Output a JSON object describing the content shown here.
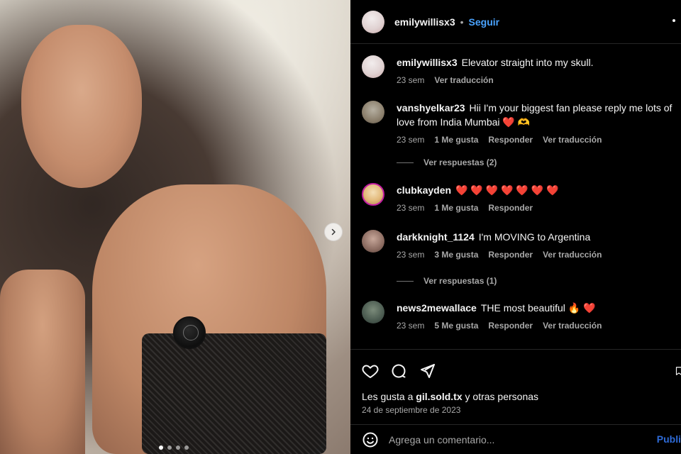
{
  "post": {
    "username": "emilywillisx3",
    "separator": "•",
    "follow_label": "Seguir"
  },
  "comments": [
    {
      "username": "emilywillisx3",
      "text": "Elevator straight into my skull.",
      "time": "23 sem",
      "translate_label": "Ver traducción"
    },
    {
      "username": "vanshyelkar23",
      "text": "Hii I'm your biggest fan please reply me lots of love from India Mumbai ❤️ 🫶",
      "time": "23 sem",
      "likes": "1 Me gusta",
      "reply_label": "Responder",
      "translate_label": "Ver traducción",
      "view_replies": "Ver respuestas (2)"
    },
    {
      "username": "clubkayden",
      "text": "❤️ ❤️ ❤️ ❤️ ❤️ ❤️ ❤️",
      "time": "23 sem",
      "likes": "1 Me gusta",
      "reply_label": "Responder"
    },
    {
      "username": "darkknight_1124",
      "text": "I'm MOVING to Argentina",
      "time": "23 sem",
      "likes": "3 Me gusta",
      "reply_label": "Responder",
      "translate_label": "Ver traducción",
      "view_replies": "Ver respuestas (1)"
    },
    {
      "username": "news2mewallace",
      "text": "THE most beautiful 🔥 ❤️",
      "time": "23 sem",
      "likes": "5 Me gusta",
      "reply_label": "Responder",
      "translate_label": "Ver traducción"
    }
  ],
  "footer": {
    "likes_prefix": "Les gusta a ",
    "likes_user": "gil.sold.tx",
    "likes_suffix": " y otras personas",
    "date": "24 de septiembre de 2023"
  },
  "composer": {
    "placeholder": "Agrega un comentario...",
    "publish_label": "Publi"
  },
  "icons": {
    "like": "heart-icon",
    "comment": "comment-icon",
    "share": "send-icon",
    "emoji": "smiley-icon",
    "next": "chevron-right-icon",
    "more": "more-icon",
    "bookmark": "bookmark-icon"
  }
}
